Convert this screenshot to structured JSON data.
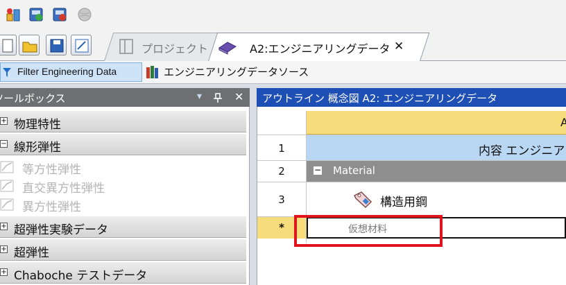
{
  "tabs": {
    "project": "プロジェクト",
    "engineering_data": "A2:エンジニアリングデータ",
    "close_symbol": "✕"
  },
  "toolbar": {
    "filter_label": "Filter Engineering Data",
    "sources_label": "エンジニアリングデータソース"
  },
  "toolbox": {
    "title": "ツールボックス",
    "pin_symbol": "ㅁ",
    "close_symbol": "✕",
    "dropdown_symbol": "▾",
    "categories": [
      {
        "label": "物理特性",
        "symbol": "+"
      },
      {
        "label": "線形弾性",
        "symbol": "−"
      }
    ],
    "sub_items": [
      "等方性弾性",
      "直交異方性弾性",
      "異方性弾性"
    ],
    "categories_after": [
      {
        "label": "超弾性実験データ",
        "symbol": "+"
      },
      {
        "label": "超弾性",
        "symbol": "+"
      },
      {
        "label": "Chaboche テストデータ",
        "symbol": "+"
      }
    ]
  },
  "outline": {
    "title": "アウトライン 概念図 A2: エンジニアリングデータ",
    "column_letter": "A",
    "row_numbers": [
      "1",
      "2",
      "3",
      "*"
    ],
    "header_cell": "内容 エンジニアリ",
    "group_label": "Material",
    "group_symbol": "−",
    "material_name": "構造用鋼",
    "new_material_placeholder": "仮想材料"
  },
  "colors": {
    "outline_header": "#1e4fb4",
    "toolbox_header": "#6d6f73",
    "column_header": "#f7dc7c",
    "row1": "#b9d7f3",
    "highlight": "#e0141e"
  }
}
